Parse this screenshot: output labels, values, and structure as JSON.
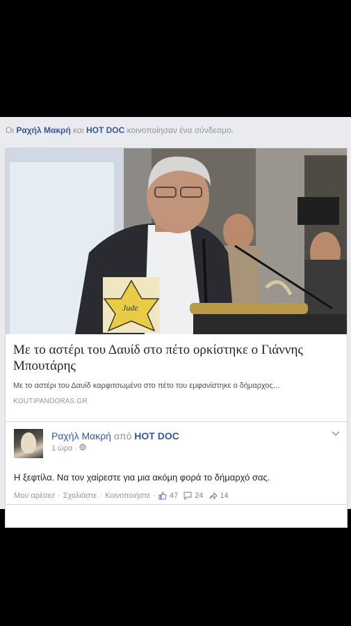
{
  "share_header": {
    "prefix": "Οι",
    "actor1": "Ραχήλ Μακρή",
    "conj": "και",
    "actor2": "HOT DOC",
    "suffix": "κοινοποίησαν ένα σύνδεσμο."
  },
  "link_card": {
    "title": "Με το αστέρι του Δαυίδ στο πέτο ορκίστηκε ο Γιάννης Μπουτάρης",
    "description": "Με το αστέρι του Δαυίδ καρφιτσωμένο στο πέτο του εμφανίστηκε ο δήμαρχος...",
    "domain": "KOUTIPANDORAS.GR",
    "badge_text": "Jude"
  },
  "comment": {
    "author": "Ραχήλ Μακρή",
    "via_text": "από",
    "page": "HOT DOC",
    "time": "1 ώρα",
    "separator": "·",
    "text": "Η ξεφτίλα. Να τον χαίρεστε για μια ακόμη φορά το δήμαρχό σας.",
    "actions": {
      "like": "Μου αρέσει!",
      "comment": "Σχολιάστε",
      "share": "Κοινοποιήστε",
      "sep": "·",
      "likes_count": "47",
      "comments_count": "24",
      "shares_count": "14"
    }
  },
  "icons": [
    "globe-icon",
    "like-icon",
    "comment-icon",
    "share-icon",
    "chevron-down-icon"
  ],
  "colors": {
    "link": "#365899",
    "meta": "#90949c",
    "text": "#1d2129",
    "background": "#e9ebee"
  }
}
